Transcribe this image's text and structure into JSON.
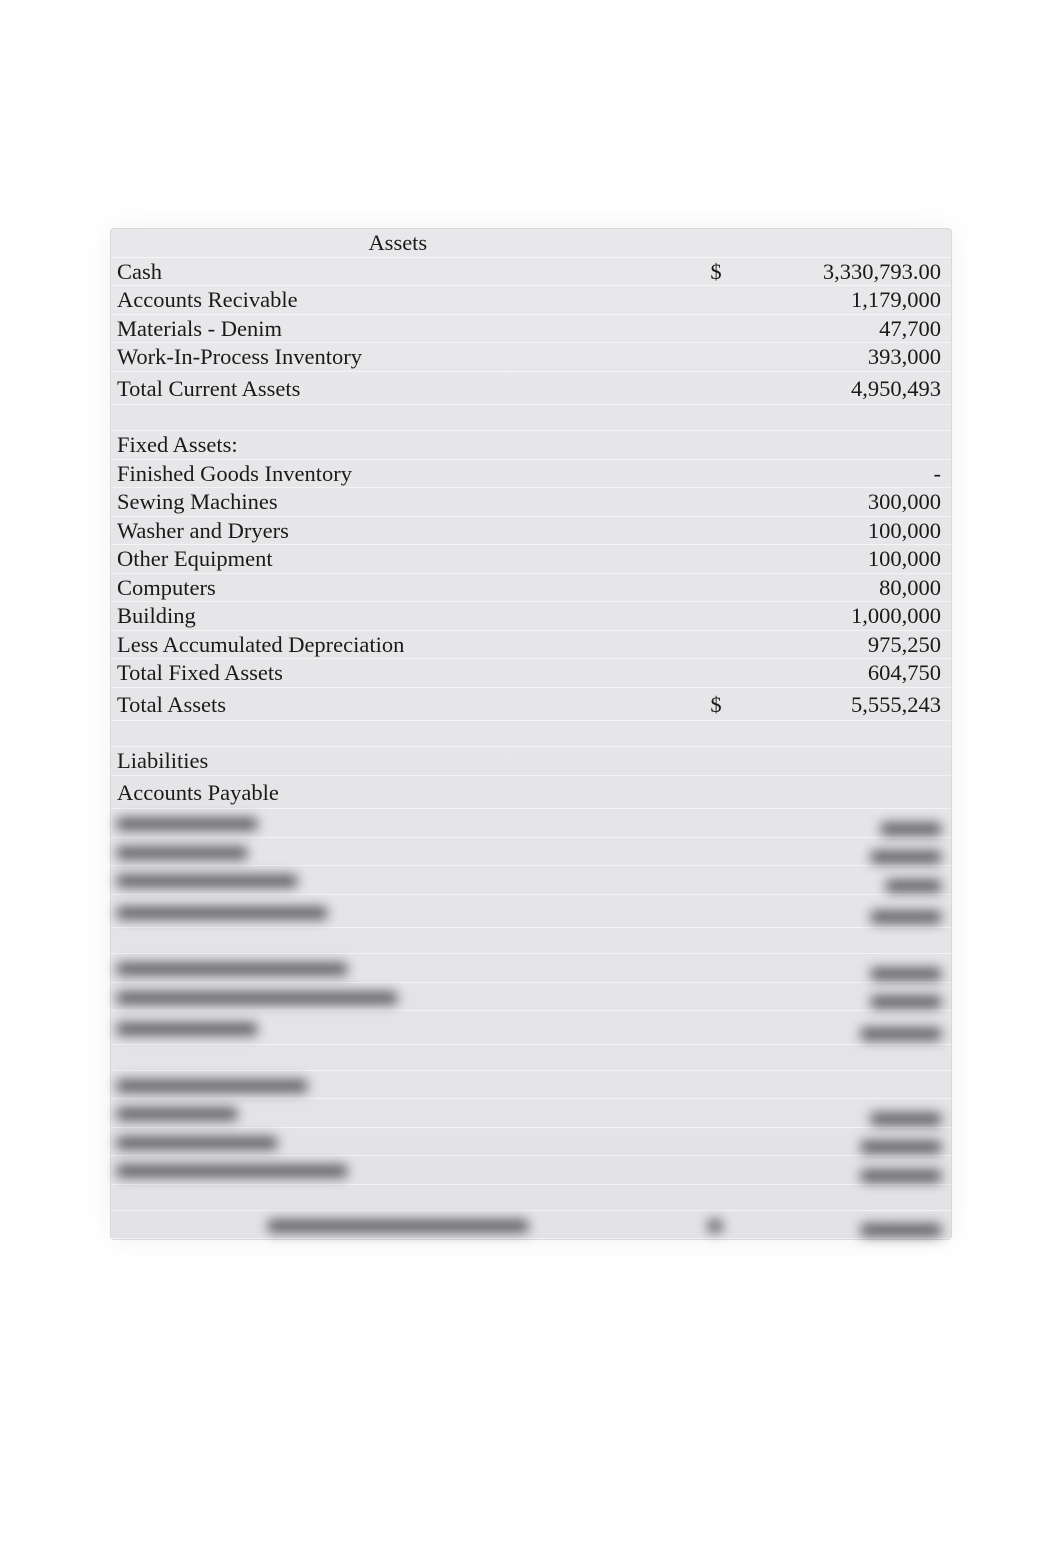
{
  "sections": {
    "assets_header": "Assets",
    "current_assets": [
      {
        "label": "Cash",
        "currency": "$",
        "value": "3,330,793.00"
      },
      {
        "label": "Accounts Recivable",
        "currency": "",
        "value": "1,179,000"
      },
      {
        "label": "Materials - Denim",
        "currency": "",
        "value": "47,700"
      },
      {
        "label": "Work-In-Process Inventory",
        "currency": "",
        "value": "393,000"
      }
    ],
    "total_current_assets": {
      "label": "Total Current Assets",
      "currency": "",
      "value": "4,950,493"
    },
    "fixed_assets_header": "Fixed Assets:",
    "fixed_assets": [
      {
        "label": "Finished Goods Inventory",
        "currency": "",
        "value": "-"
      },
      {
        "label": "Sewing Machines",
        "currency": "",
        "value": "300,000"
      },
      {
        "label": "Washer and Dryers",
        "currency": "",
        "value": "100,000"
      },
      {
        "label": "Other Equipment",
        "currency": "",
        "value": "100,000"
      },
      {
        "label": "Computers",
        "currency": "",
        "value": "80,000"
      },
      {
        "label": "Building",
        "currency": "",
        "value": "1,000,000"
      },
      {
        "label": "Less Accumulated Depreciation",
        "currency": "",
        "value": "975,250"
      }
    ],
    "total_fixed_assets": {
      "label": "Total Fixed Assets",
      "currency": "",
      "value": "604,750"
    },
    "total_assets": {
      "label": "Total Assets",
      "currency": "$",
      "value": "5,555,243"
    },
    "liabilities_header": "Liabilities",
    "accounts_payable": {
      "label": "Accounts Payable",
      "currency": "",
      "value": ""
    }
  },
  "obscured": {
    "group1": [
      {
        "lw": 140,
        "vw": 60
      },
      {
        "lw": 130,
        "vw": 70
      },
      {
        "lw": 180,
        "vw": 55
      }
    ],
    "group1_total": {
      "lw": 210,
      "vw": 70
    },
    "group2": [
      {
        "lw": 230,
        "vw": 70
      },
      {
        "lw": 280,
        "vw": 70
      }
    ],
    "group2_total": {
      "lw": 140,
      "vw": 80
    },
    "equity_header": {
      "lw": 190
    },
    "group3": [
      {
        "lw": 120,
        "vw": 70
      },
      {
        "lw": 160,
        "vw": 80
      }
    ],
    "group3_total": {
      "lw": 230,
      "vw": 80
    },
    "footer": {
      "lw": 260,
      "vw": 80,
      "cw": 14
    }
  }
}
